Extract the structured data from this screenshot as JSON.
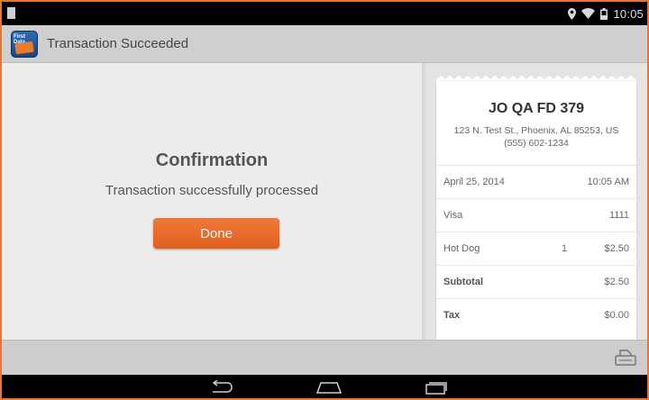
{
  "status_bar": {
    "time": "10:05",
    "icons": [
      "notification-icon",
      "location-icon",
      "wifi-icon",
      "battery-icon"
    ]
  },
  "action_bar": {
    "app_icon_text": "First Data",
    "title": "Transaction Succeeded"
  },
  "confirmation": {
    "title": "Confirmation",
    "message": "Transaction successfully processed",
    "done_label": "Done",
    "accent_color": "#e8672a"
  },
  "receipt": {
    "merchant_name": "JO QA FD  379",
    "address_line1": "123 N. Test St., Phoenix, AL 85253, US",
    "address_line2": "(555) 602-1234",
    "rows": [
      {
        "label": "April 25, 2014",
        "qty": "",
        "value": "10:05 AM"
      },
      {
        "label": "Visa",
        "qty": "",
        "value": "1111"
      },
      {
        "label": "Hot Dog",
        "qty": "1",
        "value": "$2.50"
      },
      {
        "label": "Subtotal",
        "qty": "",
        "value": "$2.50"
      },
      {
        "label": "Tax",
        "qty": "",
        "value": "$0.00"
      }
    ]
  },
  "bottom_bar": {
    "icons": [
      "print-icon"
    ]
  },
  "nav_bar": {
    "icons": [
      "back-icon",
      "home-icon",
      "recent-apps-icon"
    ]
  }
}
